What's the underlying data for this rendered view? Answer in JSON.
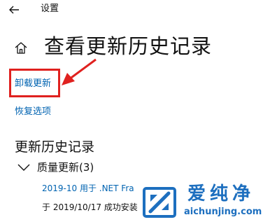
{
  "window": {
    "title": "设置"
  },
  "header": {
    "page_title": "查看更新历史记录"
  },
  "links": {
    "uninstall_updates": "卸载更新",
    "recovery_options": "恢复选项"
  },
  "history": {
    "heading": "更新历史记录",
    "groups": [
      {
        "label": "质量更新(3)",
        "expanded": true,
        "items": [
          {
            "title": "2019-10 用于 .NET Fra",
            "status": "于 2019/10/17 成功安装"
          }
        ]
      }
    ]
  },
  "watermark": {
    "name": "爱纯净",
    "url": "aichunjing.com"
  },
  "colors": {
    "link": "#0063b1",
    "annotation": "#e0211f",
    "watermark": "#1d6fbf"
  },
  "icons": {
    "back": "back-arrow-icon",
    "home": "home-icon",
    "expand": "chevron-down-icon"
  }
}
